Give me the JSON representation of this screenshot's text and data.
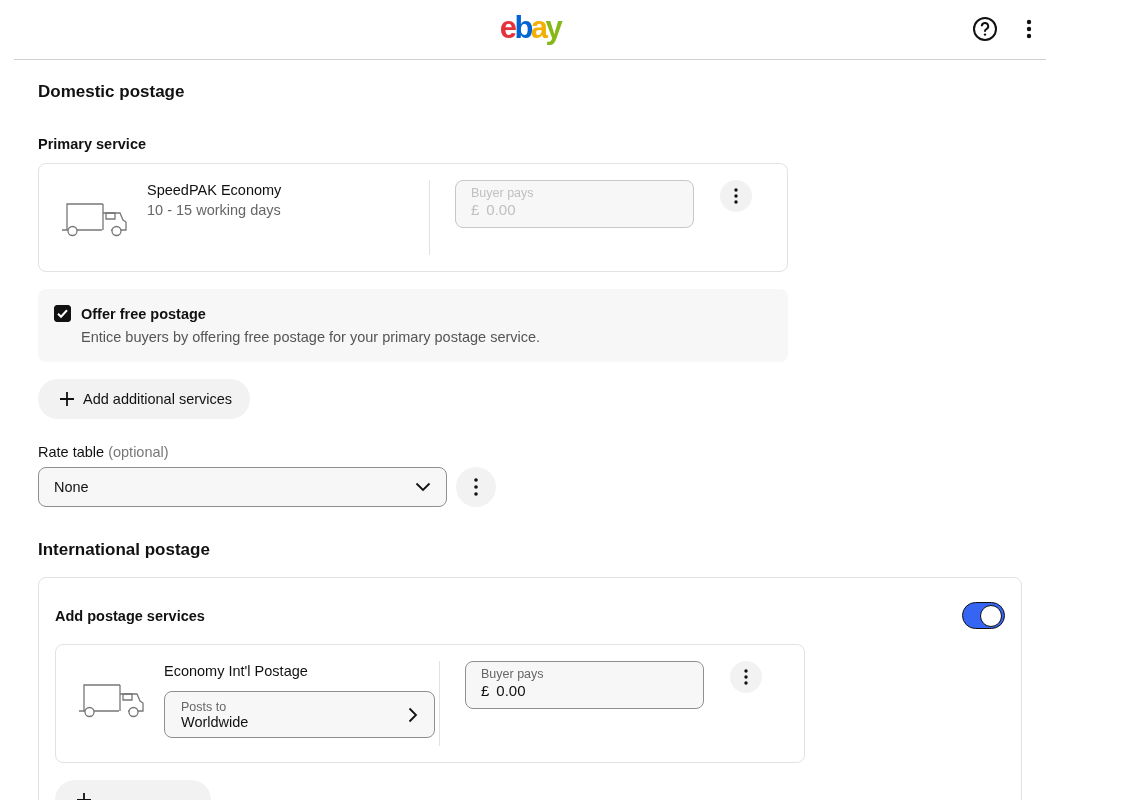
{
  "header": {
    "logo": "ebay"
  },
  "domestic": {
    "title": "Domestic postage",
    "primary_label": "Primary service",
    "service": {
      "name": "SpeedPAK Economy",
      "duration": "10 - 15 working days",
      "price": {
        "label": "Buyer pays",
        "currency": "£",
        "value": "0.00",
        "disabled": true
      }
    },
    "free_postage": {
      "label": "Offer free postage",
      "description": "Entice buyers by offering free postage for your primary postage service.",
      "checked": true
    },
    "add_button": "Add additional services",
    "rate_table": {
      "label": "Rate table",
      "optional": "(optional)",
      "value": "None"
    }
  },
  "international": {
    "title": "International postage",
    "section_label": "Add postage services",
    "enabled": true,
    "service": {
      "name": "Economy Int'l Postage",
      "posts_to": {
        "label": "Posts to",
        "value": "Worldwide"
      },
      "price": {
        "label": "Buyer pays",
        "currency": "£",
        "value": "0.00",
        "disabled": false
      }
    }
  }
}
